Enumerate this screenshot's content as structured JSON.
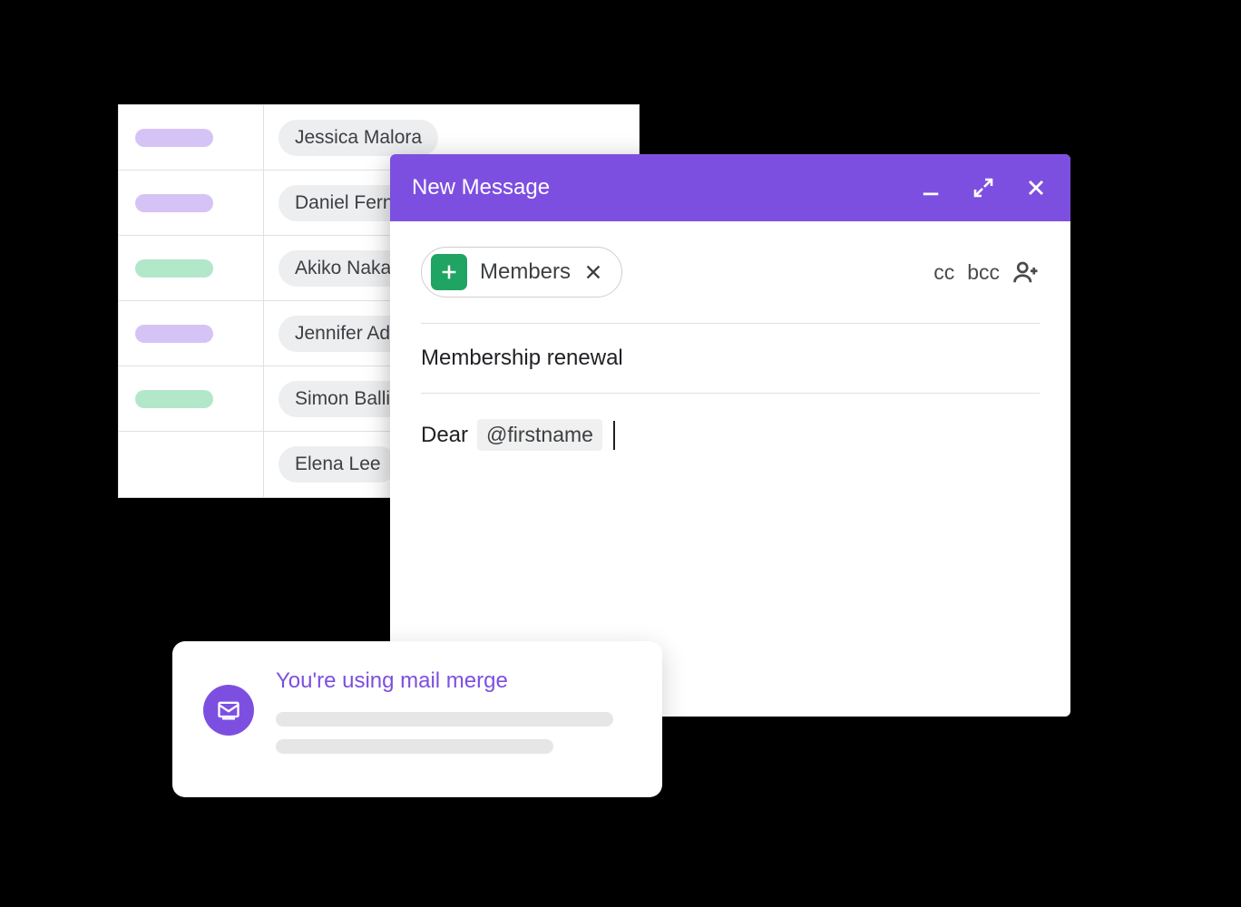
{
  "sheet": {
    "rows": [
      {
        "pill_color": "purple",
        "name": "Jessica Malora"
      },
      {
        "pill_color": "purple",
        "name": "Daniel Ferna"
      },
      {
        "pill_color": "green",
        "name": "Akiko Nakam"
      },
      {
        "pill_color": "purple",
        "name": "Jennifer Ada"
      },
      {
        "pill_color": "green",
        "name": "Simon Ballin"
      },
      {
        "pill_color": "",
        "name": "Elena Lee"
      }
    ]
  },
  "compose": {
    "title": "New Message",
    "recipient_chip": "Members",
    "cc_label": "cc",
    "bcc_label": "bcc",
    "subject": "Membership renewal",
    "body_prefix": "Dear",
    "merge_tag": "@firstname"
  },
  "tip": {
    "title": "You're using mail merge"
  }
}
